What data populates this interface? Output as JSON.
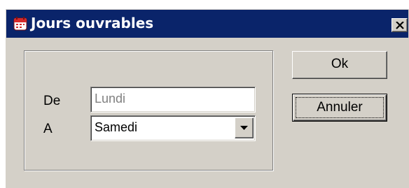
{
  "window": {
    "title": "Jours ouvrables",
    "icon": "calendar-icon",
    "close_icon": "close-icon"
  },
  "form": {
    "from_label": "De",
    "from_value": "Lundi",
    "to_label": "A",
    "to_value": "Samedi",
    "dropdown_icon": "chevron-down-icon"
  },
  "buttons": {
    "ok_label": "Ok",
    "cancel_label": "Annuler"
  },
  "colors": {
    "titlebar": "#0a246a",
    "face": "#d4d0c8",
    "disabled_text": "#808080",
    "calendar_icon_red": "#d42a2a"
  }
}
